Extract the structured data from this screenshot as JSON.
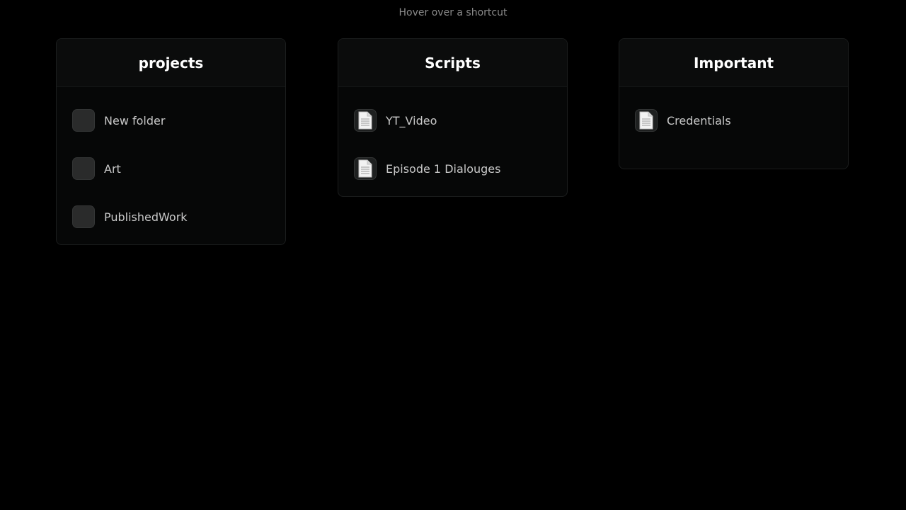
{
  "hint": "Hover over a shortcut",
  "cards": [
    {
      "title": "projects",
      "items": [
        {
          "label": "New folder",
          "icon": "folder-icon"
        },
        {
          "label": "Art",
          "icon": "folder-icon"
        },
        {
          "label": "PublishedWork",
          "icon": "folder-icon"
        }
      ]
    },
    {
      "title": "Scripts",
      "items": [
        {
          "label": "YT_Video",
          "icon": "document-icon"
        },
        {
          "label": "Episode 1 Dialouges",
          "icon": "document-icon"
        }
      ]
    },
    {
      "title": "Important",
      "items": [
        {
          "label": "Credentials",
          "icon": "document-icon"
        }
      ]
    }
  ],
  "colors": {
    "background": "#000000",
    "card_background": "#060707",
    "card_header": "#0b0c0c",
    "title_text": "#ffffff",
    "item_text": "#c9c9c9",
    "hint_text": "#8a8a8a"
  }
}
